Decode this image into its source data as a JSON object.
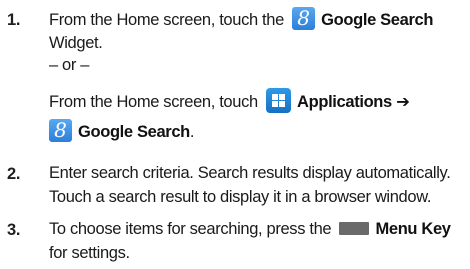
{
  "steps": [
    {
      "number": "1.",
      "line1_prefix": "From the Home screen, touch the",
      "line1_link": "Google Search",
      "line2": "Widget.",
      "separator": "– or –",
      "line4_prefix": "From the Home screen, touch",
      "line4_link": "Applications",
      "arrow": "➔",
      "line5_link": "Google Search",
      "line5_suffix": "."
    },
    {
      "number": "2.",
      "line1": "Enter search criteria. Search results display automatically.",
      "line2": "Touch a search result to display it in a browser window."
    },
    {
      "number": "3.",
      "line1_prefix": "To choose items for searching, press the",
      "line1_link": "Menu Key",
      "line2": "for settings."
    }
  ],
  "icons": {
    "google_icon_glyph": "8",
    "google_icon_color": "#3a8fe3",
    "applications_icon_color": "#1f86d6",
    "menu_key_color": "#6a6a6a"
  }
}
